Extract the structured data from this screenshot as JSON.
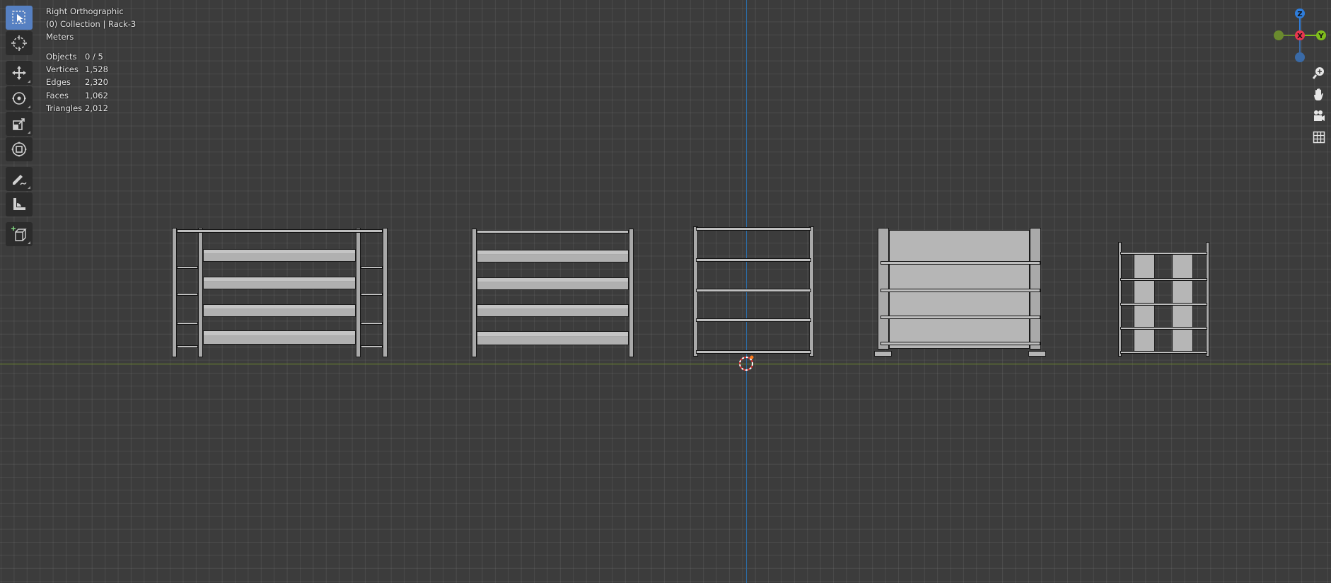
{
  "viewport": {
    "view_name": "Right Orthographic",
    "collection": "(0) Collection | Rack-3",
    "units": "Meters"
  },
  "stats": [
    {
      "label": "Objects",
      "value": "0 / 5"
    },
    {
      "label": "Vertices",
      "value": "1,528"
    },
    {
      "label": "Edges",
      "value": "2,320"
    },
    {
      "label": "Faces",
      "value": "1,062"
    },
    {
      "label": "Triangles",
      "value": "2,012"
    }
  ],
  "gizmo": {
    "z_label": "Z",
    "x_label": "X",
    "y_label": "Y",
    "colors": {
      "z": "#2f7ddb",
      "x": "#e8364f",
      "y": "#7fbd1d"
    }
  },
  "toolbar": {
    "tools": [
      "select-box-tool",
      "cursor-tool",
      "move-tool",
      "rotate-tool",
      "scale-tool",
      "transform-tool",
      "annotate-tool",
      "measure-tool",
      "add-cube-tool"
    ],
    "active_tool": "select-box-tool"
  },
  "navigation": [
    "zoom-icon",
    "pan-hand-icon",
    "camera-icon",
    "grid-icon"
  ],
  "colors": {
    "background": "#3c3c3c",
    "axis_x": "#6f8a2e",
    "axis_y": "#2b6aa3",
    "active_tool": "#5680c2"
  }
}
